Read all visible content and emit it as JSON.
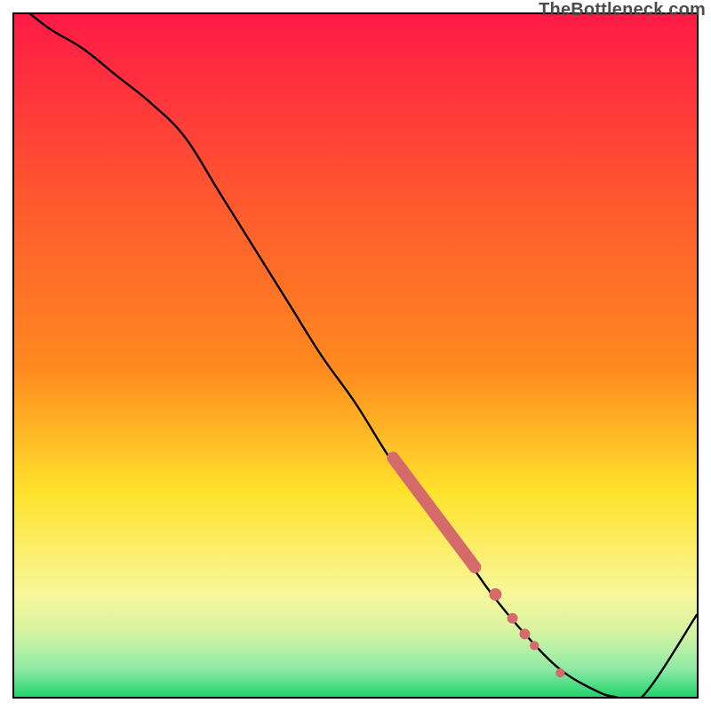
{
  "watermark": "TheBottleneck.com",
  "colors": {
    "top": "#ff1a46",
    "mid_upper": "#ff8a1f",
    "mid": "#ffe22b",
    "mid_lower_pale": "#f8f79b",
    "lower_band1": "#d9f4a0",
    "lower_band2": "#b6f0a6",
    "lower_band3": "#8de9a4",
    "bottom": "#1fd36b",
    "curve": "#000000",
    "markers": "#d46a6a"
  },
  "chart_data": {
    "type": "line",
    "title": "",
    "xlabel": "",
    "ylabel": "",
    "xlim": [
      0,
      100
    ],
    "ylim": [
      0,
      100
    ],
    "grid": false,
    "legend": false,
    "series": [
      {
        "name": "curve",
        "x": [
          0,
          5,
          10,
          15,
          20,
          25,
          30,
          35,
          40,
          45,
          50,
          55,
          60,
          65,
          70,
          75,
          80,
          85,
          88,
          92,
          100
        ],
        "values": [
          102,
          98,
          95,
          91,
          87,
          82,
          74,
          66,
          58,
          50,
          43,
          35,
          28,
          22,
          15,
          9,
          4,
          1,
          0,
          0,
          12
        ]
      }
    ],
    "markers_thick_segment": {
      "x_start": 55.5,
      "x_end": 67.5,
      "y_start": 35,
      "y_end": 19
    },
    "markers_dots": [
      {
        "x": 70.5,
        "y": 15.0
      },
      {
        "x": 73.0,
        "y": 11.5
      },
      {
        "x": 74.8,
        "y": 9.2
      },
      {
        "x": 76.2,
        "y": 7.5
      },
      {
        "x": 80.0,
        "y": 3.5
      }
    ]
  }
}
